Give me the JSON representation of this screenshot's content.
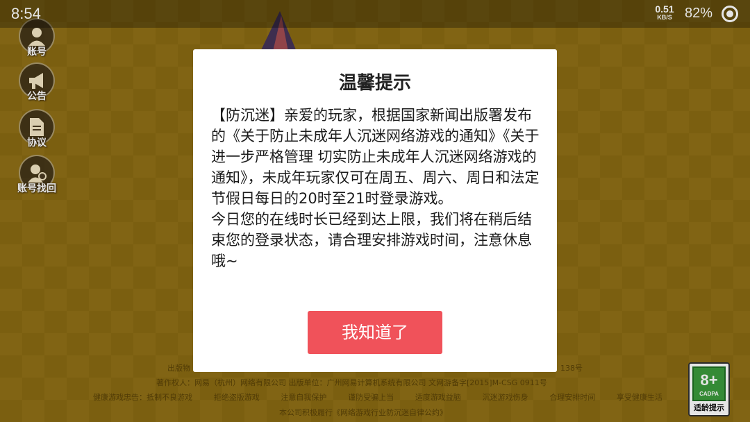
{
  "status_bar": {
    "time": "8:54",
    "net_speed_value": "0.51",
    "net_speed_unit": "KB/S",
    "battery_percent": "82%"
  },
  "side_menu": [
    {
      "label": "账号",
      "icon": "user-icon"
    },
    {
      "label": "公告",
      "icon": "megaphone-icon"
    },
    {
      "label": "协议",
      "icon": "document-icon"
    },
    {
      "label": "账号找回",
      "icon": "account-recovery-icon"
    }
  ],
  "dialog": {
    "title": "温馨提示",
    "paragraph1": "【防沉迷】亲爱的玩家，根据国家新闻出版署发布的《关于防止未成年人沉迷网络游戏的通知》《关于进一步严格管理 切实防止未成年人沉迷网络游戏的通知》，未成年玩家仅可在周五、周六、周日和法定节假日每日的20时至21时登录游戏。",
    "paragraph2": "今日您的在线时长已经到达上限，我们将在稍后结束您的登录状态，请合理安排游戏时间，注意休息哦~",
    "ok_label": "我知道了"
  },
  "footer": {
    "line1_left": "出版物",
    "line1_right": "138号",
    "line2": "著作权人：网易（杭州）网络有限公司 出版单位：广州网易计算机系统有限公司 文网游备字[2015]M-CSG 0911号",
    "health_items": [
      "健康游戏忠告：抵制不良游戏",
      "拒绝盗版游戏",
      "注意自我保护",
      "谨防受骗上当",
      "适度游戏益脑",
      "沉迷游戏伤身",
      "合理安排时间",
      "享受健康生活"
    ],
    "line4": "本公司积极履行《网络游戏行业防沉迷自律公约》"
  },
  "age_rating": {
    "rating": "8+",
    "org": "CADPA",
    "label": "适龄提示"
  },
  "colors": {
    "button": "#f0525a",
    "background": "#a8841a",
    "rating_green": "#3a9a3c"
  }
}
